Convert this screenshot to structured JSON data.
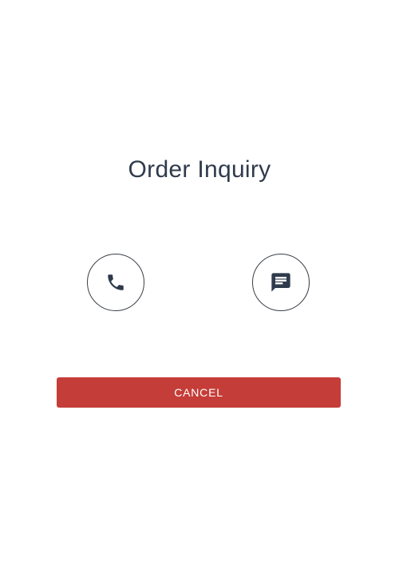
{
  "dialog": {
    "title": "Order Inquiry",
    "actions": [
      {
        "name": "call",
        "icon": "phone-icon"
      },
      {
        "name": "message",
        "icon": "chat-icon"
      }
    ],
    "cancel_label": "CANCEL"
  },
  "colors": {
    "title_text": "#2f3b4c",
    "icon": "#2f3b4c",
    "circle_border": "#3a3f47",
    "cancel_bg": "#c53d38",
    "cancel_text": "#ffffff",
    "background": "#ffffff"
  }
}
